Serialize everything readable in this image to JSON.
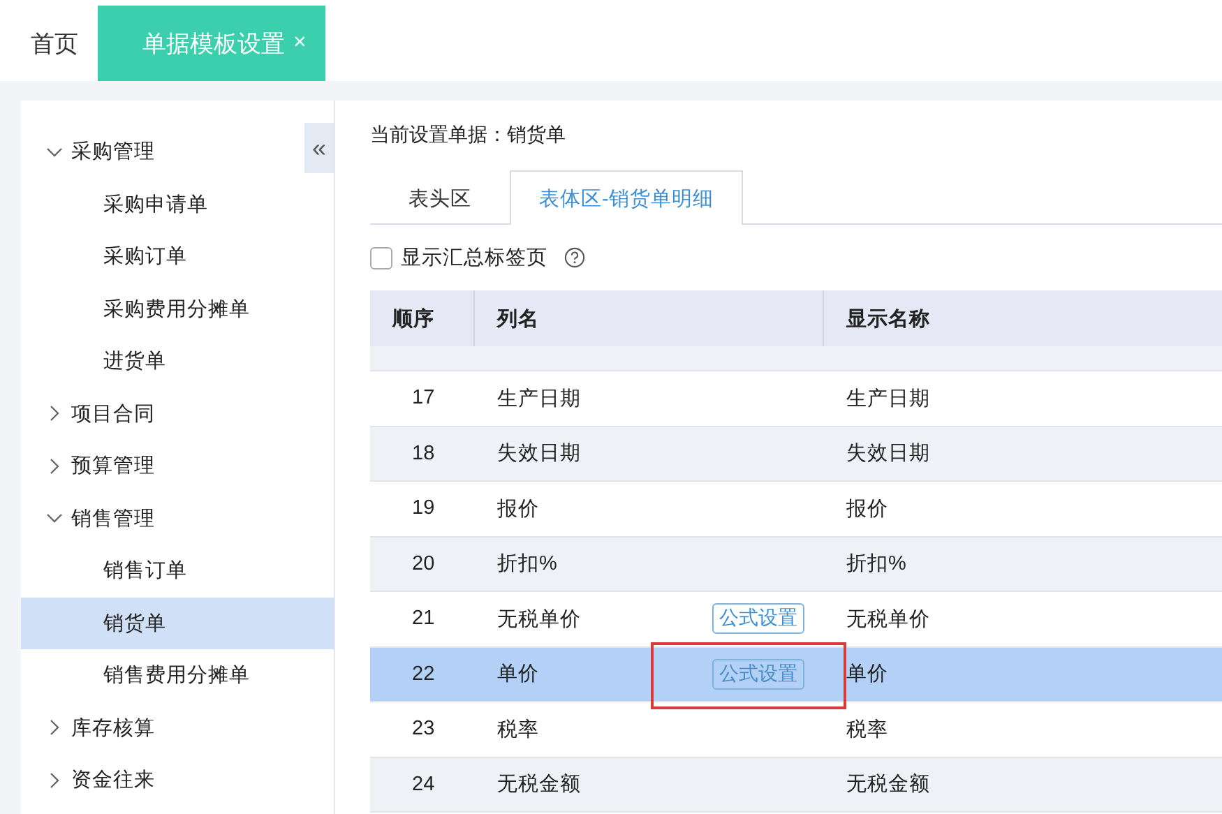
{
  "tabs": [
    {
      "label": "首页",
      "selected": false
    },
    {
      "label": "单据模板设置",
      "selected": true,
      "close": "×"
    }
  ],
  "sidebar": {
    "collapse": "«",
    "items": [
      {
        "label": "采购管理",
        "expanded": true,
        "children": [
          {
            "label": "采购申请单",
            "selected": false
          },
          {
            "label": "采购订单",
            "selected": false
          },
          {
            "label": "采购费用分摊单",
            "selected": false
          },
          {
            "label": "进货单",
            "selected": false
          }
        ]
      },
      {
        "label": "项目合同",
        "expanded": false
      },
      {
        "label": "预算管理",
        "expanded": false
      },
      {
        "label": "销售管理",
        "expanded": true,
        "children": [
          {
            "label": "销售订单",
            "selected": false
          },
          {
            "label": "销货单",
            "selected": true
          },
          {
            "label": "销售费用分摊单",
            "selected": false
          }
        ]
      },
      {
        "label": "库存核算",
        "expanded": false
      },
      {
        "label": "资金往来",
        "expanded": false
      }
    ]
  },
  "content": {
    "current": "当前设置单据：销货单",
    "tabs": [
      {
        "label": "表头区",
        "selected": false
      },
      {
        "label": "表体区-销货单明细",
        "selected": true
      }
    ],
    "summary_checkbox": {
      "label": "显示汇总标签页",
      "checked": false
    },
    "table": {
      "columns": [
        "顺序",
        "列名",
        "显示名称"
      ],
      "rows": [
        {
          "order": "17",
          "name": "生产日期",
          "display": "生产日期",
          "selected": false
        },
        {
          "order": "18",
          "name": "失效日期",
          "display": "失效日期",
          "selected": false
        },
        {
          "order": "19",
          "name": "报价",
          "display": "报价",
          "selected": false
        },
        {
          "order": "20",
          "name": "折扣%",
          "display": "折扣%",
          "selected": false
        },
        {
          "order": "21",
          "name": "无税单价",
          "display": "无税单价",
          "selected": false,
          "formula_button": "公式设置"
        },
        {
          "order": "22",
          "name": "单价",
          "display": "单价",
          "selected": true,
          "formula_button": "公式设置",
          "annotated": true
        },
        {
          "order": "23",
          "name": "税率",
          "display": "税率",
          "selected": false
        },
        {
          "order": "24",
          "name": "无税金额",
          "display": "无税金额",
          "selected": false
        }
      ]
    }
  }
}
